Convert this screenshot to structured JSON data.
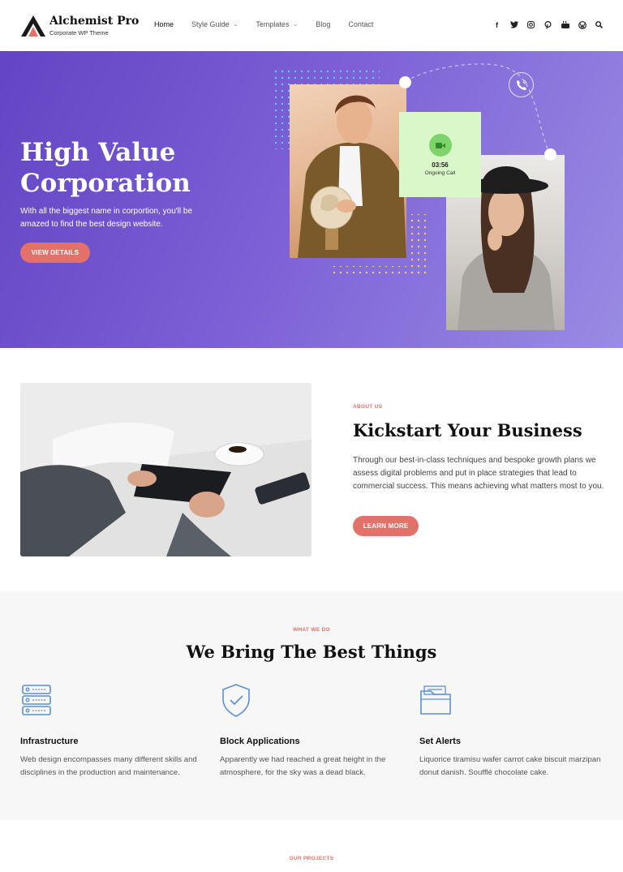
{
  "brand": {
    "name": "Alchemist Pro",
    "tagline": "Corporate WP Theme"
  },
  "nav": {
    "items": [
      {
        "label": "Home",
        "active": true,
        "has_dropdown": false
      },
      {
        "label": "Style Guide",
        "active": false,
        "has_dropdown": true
      },
      {
        "label": "Templates",
        "active": false,
        "has_dropdown": true
      },
      {
        "label": "Blog",
        "active": false,
        "has_dropdown": false
      },
      {
        "label": "Contact",
        "active": false,
        "has_dropdown": false
      }
    ],
    "social_icons": [
      "facebook-icon",
      "twitter-icon",
      "instagram-icon",
      "pinterest-icon",
      "youtube-icon",
      "wordpress-icon",
      "search-icon"
    ]
  },
  "hero": {
    "title_line1": "High Value",
    "title_line2": "Corporation",
    "subtitle": "With all the biggest name in corportion, you'll be amazed to find the best design website.",
    "button_label": "VIEW DETAILS",
    "call_card": {
      "time": "03:56",
      "label": "Ongoing Call"
    }
  },
  "about": {
    "eyebrow": "ABOUT US",
    "title": "Kickstart Your Business",
    "text": "Through our best-in-class techniques and bespoke growth plans we assess digital problems and put in place strategies that lead to commercial success. This means achieving what matters most to you.",
    "button_label": "LEARN MORE"
  },
  "services": {
    "eyebrow": "WHAT WE DO",
    "title": "We Bring The Best Things",
    "items": [
      {
        "icon": "server-icon",
        "title": "Infrastructure",
        "desc": "Web design encompasses many different skills and disciplines in the production and maintenance."
      },
      {
        "icon": "shield-check-icon",
        "title": "Block Applications",
        "desc": "Apparently we had reached a great height in the atmosphere, for the sky was a dead black."
      },
      {
        "icon": "folder-icon",
        "title": "Set Alerts",
        "desc": "Liquorice tiramisu wafer carrot cake biscuit marzipan donut danish. Soufflé chocolate cake."
      }
    ]
  },
  "projects": {
    "eyebrow": "OUR PROJECTS"
  },
  "colors": {
    "accent": "#e3716a",
    "hero_purple": "#6d52cf",
    "icon_blue": "#5b8fd6",
    "call_green": "#d9f7c8"
  }
}
